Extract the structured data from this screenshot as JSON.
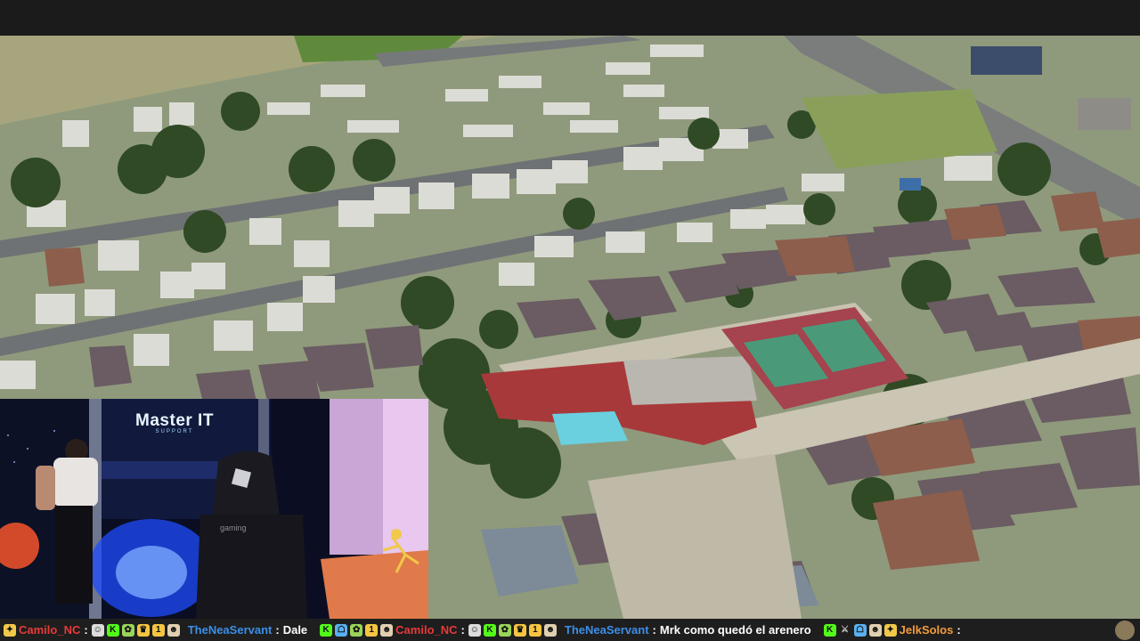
{
  "brand": {
    "name": "Master IT",
    "sub": "SUPPORT"
  },
  "chair_text": "gaming",
  "chat": [
    {
      "user": "Camilo_NC",
      "message": "",
      "color": "#e83a3a"
    },
    {
      "user": "TheNeaServant",
      "message": "Dale",
      "color": "#3c8ee8"
    },
    {
      "user": "Camilo_NC",
      "message": "",
      "color": "#e83a3a"
    },
    {
      "user": "TheNeaServant",
      "message": "Mrk como quedó el arenero",
      "color": "#3c8ee8"
    },
    {
      "user": "JelkSolos",
      "message": "",
      "color": "#f39b3a"
    }
  ],
  "icons": [
    "sparkle-icon",
    "cat-icon",
    "k-icon",
    "leaf-icon",
    "crown-icon",
    "coin-icon",
    "mascot-icon",
    "jester-icon",
    "k-icon"
  ]
}
